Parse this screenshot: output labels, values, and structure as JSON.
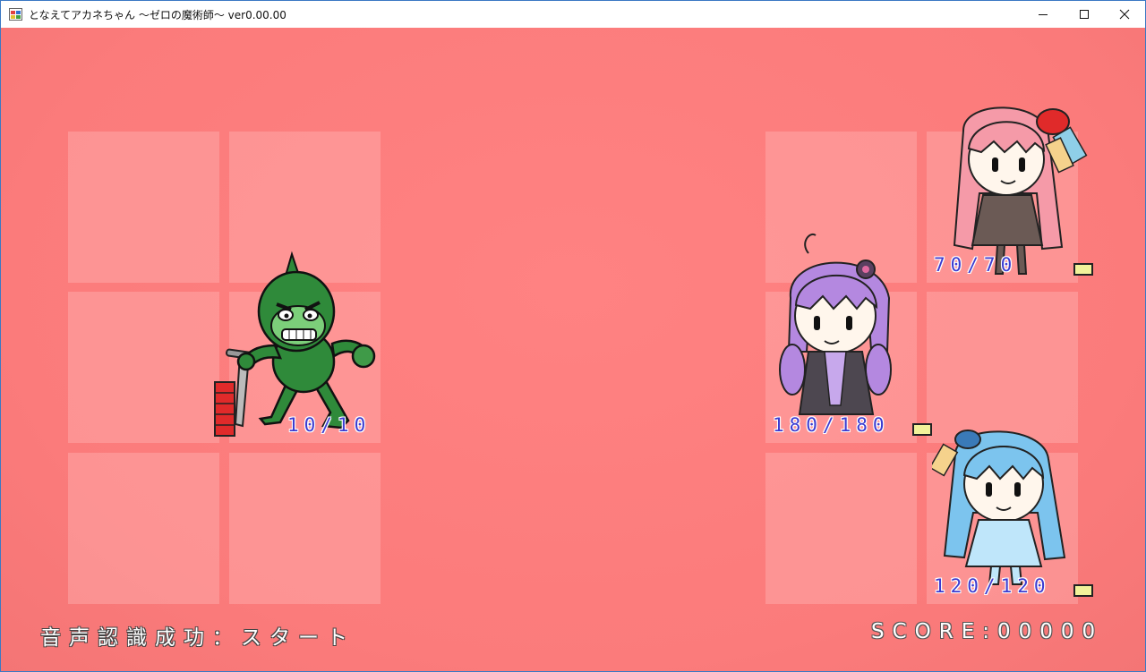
{
  "window": {
    "title": "となえてアカネちゃん 〜ゼロの魔術師〜 ver0.00.00"
  },
  "icons": {
    "app": "app-icon",
    "minimize": "minimize-icon",
    "maximize": "maximize-icon",
    "close": "close-icon"
  },
  "colors": {
    "background": "#ff8080",
    "hp_text": "#3b3bd0",
    "gauge": "#f2f29a"
  },
  "enemy": {
    "hp_text": "10/10",
    "hp_gauge_fraction": 1.0
  },
  "party": [
    {
      "hp_text": "70/70"
    },
    {
      "hp_text": "180/180"
    },
    {
      "hp_text": "120/120"
    }
  ],
  "status": {
    "text": "音声認識成功：スタート"
  },
  "score": {
    "text": "SCORE:00000"
  }
}
